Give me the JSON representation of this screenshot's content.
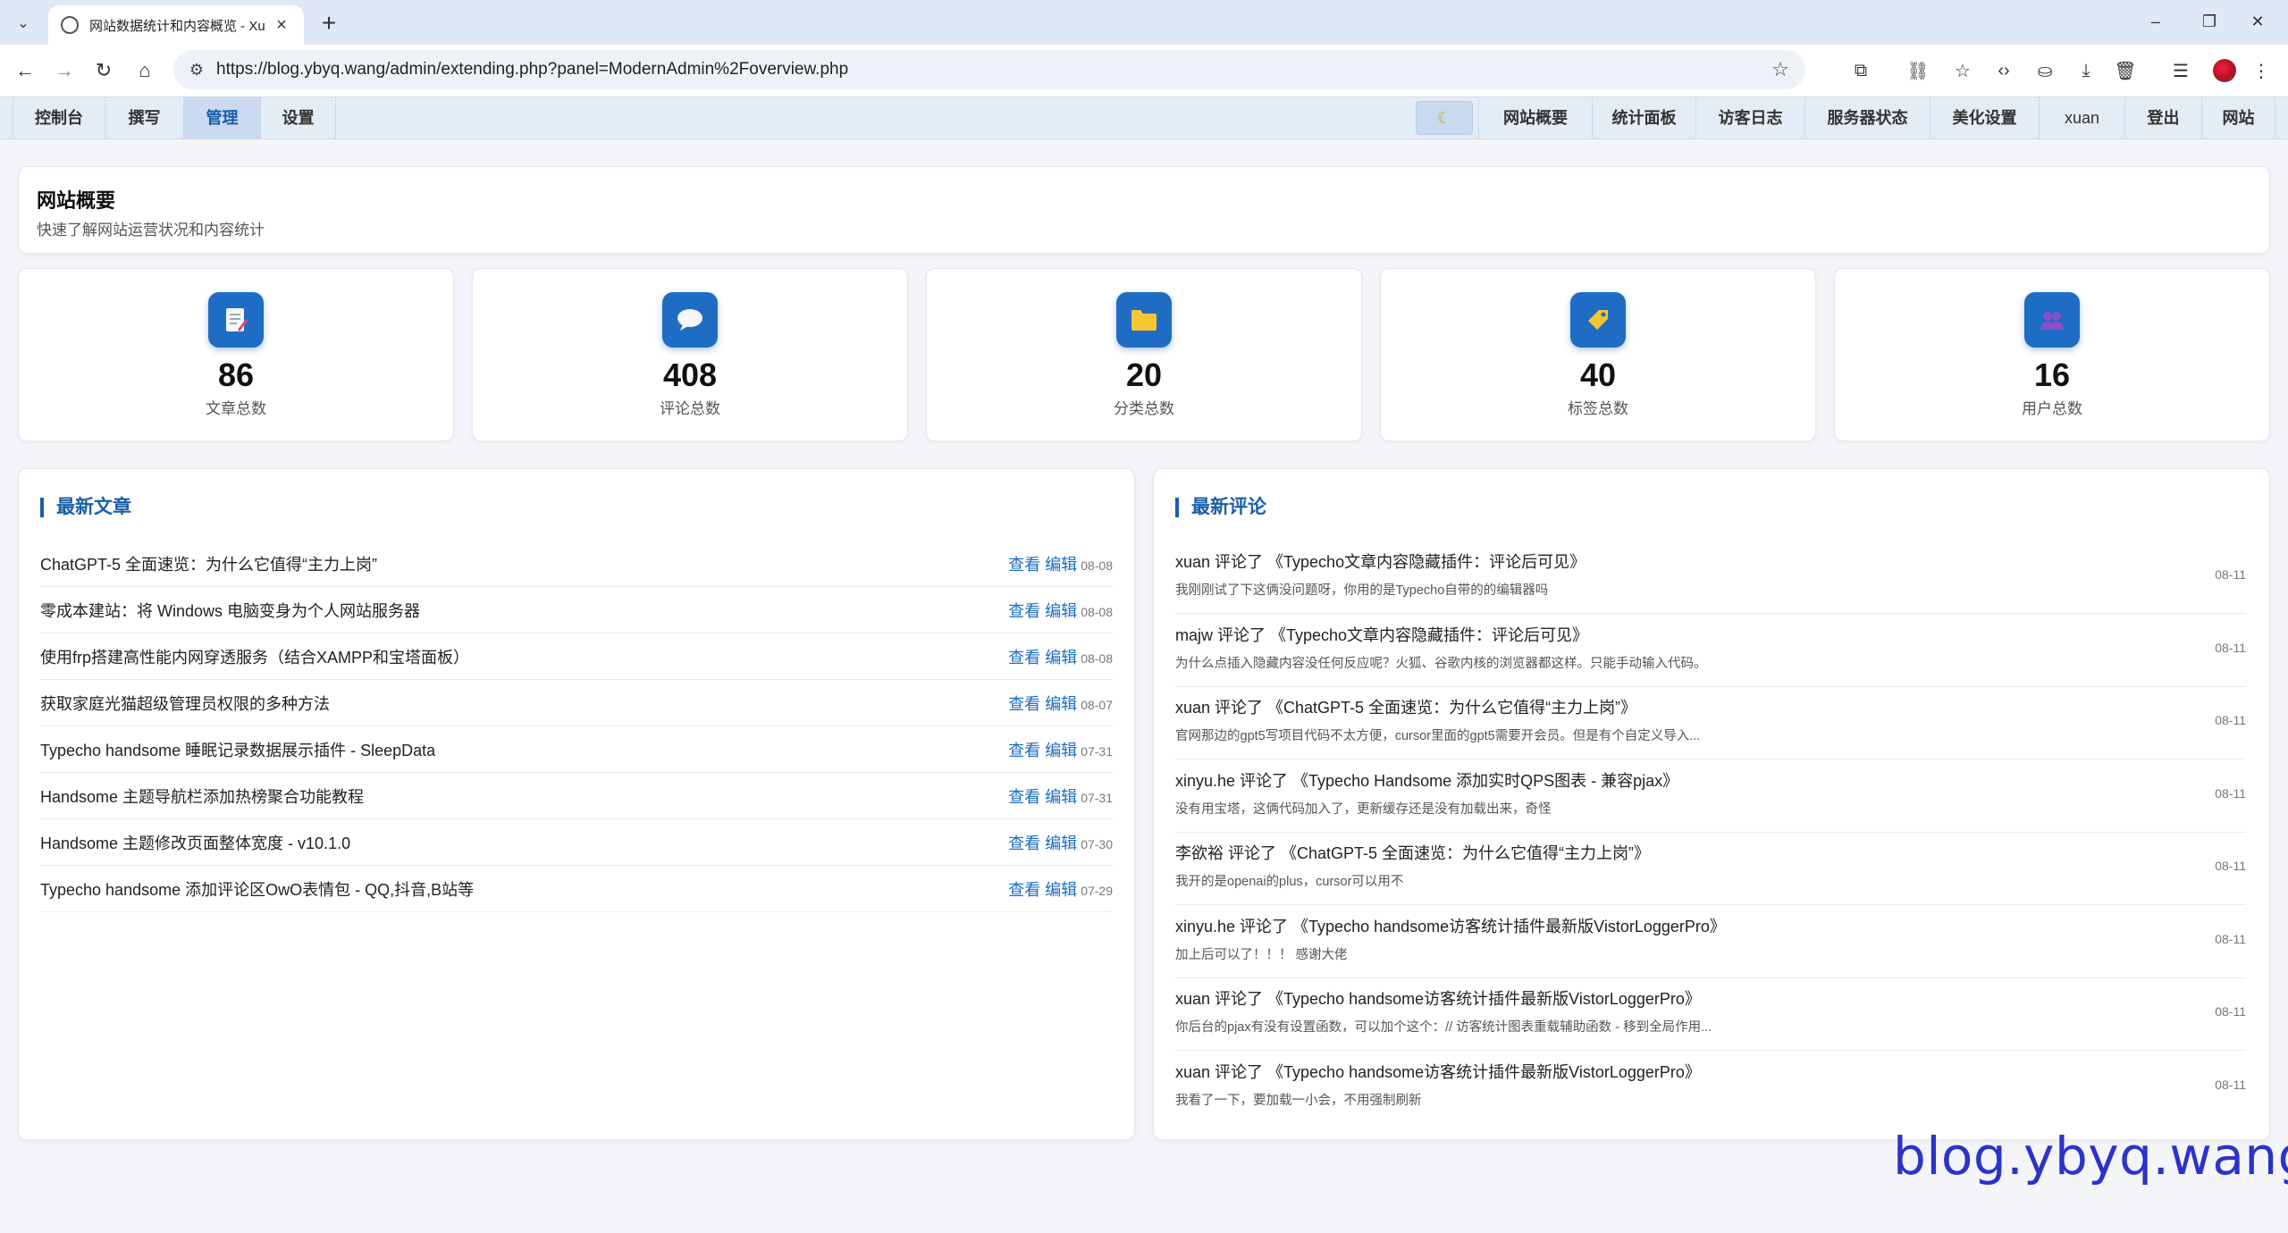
{
  "browser": {
    "tab_title": "网站数据统计和内容概览 - Xuan",
    "url": "https://blog.ybyq.wang/admin/extending.php?panel=ModernAdmin%2Foverview.php"
  },
  "nav": {
    "left": [
      "控制台",
      "撰写",
      "管理",
      "设置"
    ],
    "active": "管理",
    "right": [
      "网站概要",
      "统计面板",
      "访客日志",
      "服务器状态",
      "美化设置",
      "xuan",
      "登出",
      "网站"
    ]
  },
  "header": {
    "title": "网站概要",
    "subtitle": "快速了解网站运营状况和内容统计"
  },
  "stats": [
    {
      "value": "86",
      "label": "文章总数",
      "icon": "document-icon"
    },
    {
      "value": "408",
      "label": "评论总数",
      "icon": "speech-bubble-icon"
    },
    {
      "value": "20",
      "label": "分类总数",
      "icon": "folder-icon"
    },
    {
      "value": "40",
      "label": "标签总数",
      "icon": "tag-icon"
    },
    {
      "value": "16",
      "label": "用户总数",
      "icon": "users-icon"
    }
  ],
  "recent_posts": {
    "title": "最新文章",
    "view_label": "查看",
    "edit_label": "编辑",
    "items": [
      {
        "title": "ChatGPT-5 全面速览：为什么它值得“主力上岗”",
        "date": "08-08"
      },
      {
        "title": "零成本建站：将 Windows 电脑变身为个人网站服务器",
        "date": "08-08"
      },
      {
        "title": "使用frp搭建高性能内网穿透服务（结合XAMPP和宝塔面板）",
        "date": "08-08"
      },
      {
        "title": "获取家庭光猫超级管理员权限的多种方法",
        "date": "08-07"
      },
      {
        "title": "Typecho handsome 睡眠记录数据展示插件 - SleepData",
        "date": "07-31"
      },
      {
        "title": "Handsome 主题导航栏添加热榜聚合功能教程",
        "date": "07-31"
      },
      {
        "title": "Handsome 主题修改页面整体宽度 - v10.1.0",
        "date": "07-30"
      },
      {
        "title": "Typecho handsome 添加评论区OwO表情包 - QQ,抖音,B站等",
        "date": "07-29"
      }
    ]
  },
  "recent_comments": {
    "title": "最新评论",
    "items": [
      {
        "head": "xuan 评论了 《Typecho文章内容隐藏插件：评论后可见》",
        "body": "我刚刚试了下这俩没问题呀，你用的是Typecho自带的的编辑器吗",
        "date": "08-11"
      },
      {
        "head": "majw 评论了 《Typecho文章内容隐藏插件：评论后可见》",
        "body": "为什么点插入隐藏内容没任何反应呢？火狐、谷歌内核的浏览器都这样。只能手动输入代码。",
        "date": "08-11"
      },
      {
        "head": "xuan 评论了 《ChatGPT-5 全面速览：为什么它值得“主力上岗”》",
        "body": "官网那边的gpt5写项目代码不太方便，cursor里面的gpt5需要开会员。但是有个自定义导入...",
        "date": "08-11"
      },
      {
        "head": "xinyu.he 评论了 《Typecho Handsome 添加实时QPS图表 - 兼容pjax》",
        "body": "没有用宝塔，这俩代码加入了，更新缓存还是没有加载出来，奇怪",
        "date": "08-11"
      },
      {
        "head": "李欲裕 评论了 《ChatGPT-5 全面速览：为什么它值得“主力上岗”》",
        "body": "我开的是openai的plus，cursor可以用不",
        "date": "08-11"
      },
      {
        "head": "xinyu.he 评论了 《Typecho handsome访客统计插件最新版VistorLoggerPro》",
        "body": "加上后可以了！！！ 感谢大佬",
        "date": "08-11"
      },
      {
        "head": "xuan 评论了 《Typecho handsome访客统计插件最新版VistorLoggerPro》",
        "body": "你后台的pjax有没有设置函数，可以加个这个：// 访客统计图表重载辅助函数 - 移到全局作用...",
        "date": "08-11"
      },
      {
        "head": "xuan 评论了 《Typecho handsome访客统计插件最新版VistorLoggerPro》",
        "body": "我看了一下，要加载一小会，不用强制刷新",
        "date": "08-11"
      }
    ]
  },
  "watermark": "blog.ybyq.wang",
  "colors": {
    "accent": "#1a5ea8",
    "icon_bg": "#1f6cc4",
    "link": "#1a6cc4"
  }
}
